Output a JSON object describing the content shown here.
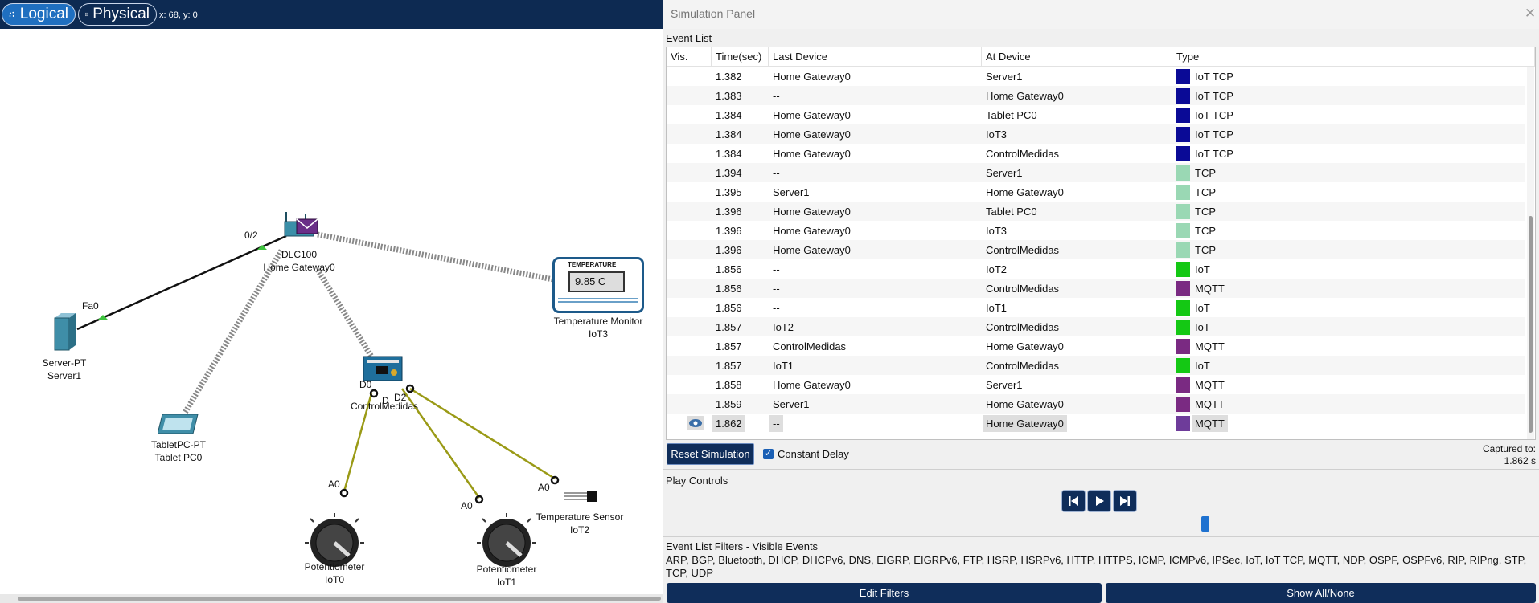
{
  "workspace": {
    "logical_label": "Logical",
    "physical_label": "Physical",
    "coord_readout": "x: 68, y: 0",
    "devices": {
      "home_gateway": {
        "model": "DLC100",
        "name": "Home Gateway0",
        "port": "0/2"
      },
      "server": {
        "model": "Server-PT",
        "name": "Server1",
        "port": "Fa0"
      },
      "tablet": {
        "model": "TabletPC-PT",
        "name": "Tablet PC0"
      },
      "temp_monitor": {
        "model": "Temperature Monitor",
        "name": "IoT3",
        "screen_title": "TEMPERATURE",
        "reading": "9.85 C"
      },
      "controller": {
        "name": "ControlMedidas",
        "port_d0": "D0",
        "port_d1": "D",
        "port_d2": "D2"
      },
      "pot0": {
        "model": "Potentiometer",
        "name": "IoT0",
        "port": "A0"
      },
      "pot1": {
        "model": "Potentiometer",
        "name": "IoT1",
        "port": "A0"
      },
      "temp_sensor": {
        "model": "Temperature Sensor",
        "name": "IoT2",
        "port": "A0"
      }
    }
  },
  "sim_panel": {
    "title": "Simulation Panel",
    "event_list_label": "Event List",
    "columns": {
      "vis": "Vis.",
      "time": "Time(sec)",
      "last": "Last Device",
      "at": "At Device",
      "type": "Type"
    },
    "events": [
      {
        "time": "1.382",
        "last": "Home Gateway0",
        "at": "Server1",
        "type": "IoT TCP",
        "color": "#0a0a96"
      },
      {
        "time": "1.383",
        "last": "--",
        "at": "Home Gateway0",
        "type": "IoT TCP",
        "color": "#0a0a96"
      },
      {
        "time": "1.384",
        "last": "Home Gateway0",
        "at": "Tablet PC0",
        "type": "IoT TCP",
        "color": "#0a0a96"
      },
      {
        "time": "1.384",
        "last": "Home Gateway0",
        "at": "IoT3",
        "type": "IoT TCP",
        "color": "#0a0a96"
      },
      {
        "time": "1.384",
        "last": "Home Gateway0",
        "at": "ControlMedidas",
        "type": "IoT TCP",
        "color": "#0a0a96"
      },
      {
        "time": "1.394",
        "last": "--",
        "at": "Server1",
        "type": "TCP",
        "color": "#9ad8b4"
      },
      {
        "time": "1.395",
        "last": "Server1",
        "at": "Home Gateway0",
        "type": "TCP",
        "color": "#9ad8b4"
      },
      {
        "time": "1.396",
        "last": "Home Gateway0",
        "at": "Tablet PC0",
        "type": "TCP",
        "color": "#9ad8b4"
      },
      {
        "time": "1.396",
        "last": "Home Gateway0",
        "at": "IoT3",
        "type": "TCP",
        "color": "#9ad8b4"
      },
      {
        "time": "1.396",
        "last": "Home Gateway0",
        "at": "ControlMedidas",
        "type": "TCP",
        "color": "#9ad8b4"
      },
      {
        "time": "1.856",
        "last": "--",
        "at": "IoT2",
        "type": "IoT",
        "color": "#14c814"
      },
      {
        "time": "1.856",
        "last": "--",
        "at": "ControlMedidas",
        "type": "MQTT",
        "color": "#7a2a82"
      },
      {
        "time": "1.856",
        "last": "--",
        "at": "IoT1",
        "type": "IoT",
        "color": "#14c814"
      },
      {
        "time": "1.857",
        "last": "IoT2",
        "at": "ControlMedidas",
        "type": "IoT",
        "color": "#14c814"
      },
      {
        "time": "1.857",
        "last": "ControlMedidas",
        "at": "Home Gateway0",
        "type": "MQTT",
        "color": "#7a2a82"
      },
      {
        "time": "1.857",
        "last": "IoT1",
        "at": "ControlMedidas",
        "type": "IoT",
        "color": "#14c814"
      },
      {
        "time": "1.858",
        "last": "Home Gateway0",
        "at": "Server1",
        "type": "MQTT",
        "color": "#7a2a82"
      },
      {
        "time": "1.859",
        "last": "Server1",
        "at": "Home Gateway0",
        "type": "MQTT",
        "color": "#7a2a82"
      },
      {
        "time": "1.862",
        "last": "--",
        "at": "Home Gateway0",
        "type": "MQTT",
        "color": "#6e3c9a",
        "current": true
      }
    ],
    "reset_label": "Reset Simulation",
    "constant_delay_label": "Constant Delay",
    "constant_delay_checked": true,
    "captured_to_label": "Captured to:",
    "captured_to_value": "1.862 s",
    "play_controls_label": "Play Controls",
    "filters_label": "Event List Filters - Visible Events",
    "filters_text": "ARP, BGP, Bluetooth, DHCP, DHCPv6, DNS, EIGRP, EIGRPv6, FTP, HSRP, HSRPv6, HTTP, HTTPS, ICMP, ICMPv6, IPSec, IoT, IoT TCP, MQTT, NDP, OSPF, OSPFv6, RIP, RIPng, STP, TCP, UDP",
    "edit_filters_label": "Edit Filters",
    "show_all_label": "Show All/None",
    "accent_color": "#0f2d5a"
  }
}
